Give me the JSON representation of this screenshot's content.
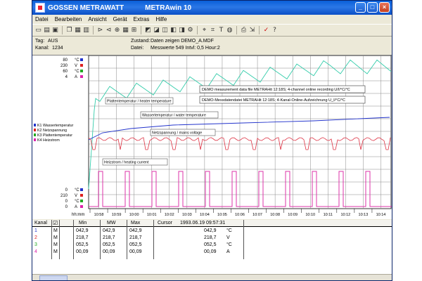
{
  "window": {
    "app_name": "GOSSEN METRAWATT",
    "title": "METRAwin 10"
  },
  "menu": [
    "Datei",
    "Bearbeiten",
    "Ansicht",
    "Gerät",
    "Extras",
    "Hilfe"
  ],
  "info": {
    "tag_label": "Tag:",
    "tag_value": "AUS",
    "kanal_label": "Kanal:",
    "kanal_value": "1234",
    "zustand_label": "Zustand:",
    "zustand_value": "Daten zeigen DEMO_A.MDF",
    "datei_label": "Datei:",
    "datei_value": "Messwerte 549  Intvl: 0,5  Hour:2"
  },
  "axis_labels": {
    "top_values": [
      "80",
      "230",
      "60",
      "4"
    ],
    "top_units": [
      "°C",
      "V",
      "°C",
      "A"
    ],
    "bottom_values": [
      "0",
      "210",
      "0",
      "0"
    ],
    "bottom_units": [
      "°C",
      "V",
      "°C",
      "A"
    ],
    "time_label": "hh:mm"
  },
  "time_ticks": [
    "10:58",
    "10:59",
    "10:00",
    "10:01",
    "10:02",
    "10:03",
    "10:04",
    "10:05",
    "10:06",
    "10:07",
    "10:08",
    "10:09",
    "10:10",
    "10:11",
    "10:12",
    "10:13",
    "10:14"
  ],
  "legend": [
    {
      "id": "K1",
      "name": "Wassertemperatur",
      "color": "#2233cc"
    },
    {
      "id": "K2",
      "name": "Netzspannung",
      "color": "#dd2222"
    },
    {
      "id": "K3",
      "name": "Plattentemperatur",
      "color": "#22aa22"
    },
    {
      "id": "K4",
      "name": "Heizstrom",
      "color": "#dd22aa"
    }
  ],
  "annotations": {
    "box1": "DEMO measurement data file METRAHit 12:18S; 4-channel online recording U/I/°C/°C",
    "box2": "DEMO-Messdatendatei METRAHit 12:18S; 4-Kanal-Online-Aufzeichnung U_I/°C/°C",
    "plate": "Plattentemperatur / heater temperature",
    "water": "Wassertemperatur / water temperature",
    "mains": "Netzspannung / mains voltage",
    "current": "Heizstrom / heating current"
  },
  "table": {
    "headers": [
      "Kanal",
      "Min",
      "MW",
      "Max",
      "Cursor",
      "1993.06.19 09:57:31"
    ],
    "rows": [
      {
        "k": "1",
        "kcolor": "#2233cc",
        "flag": "M",
        "min": "042,9",
        "mw": "042,9",
        "max": "042,9",
        "cur": "042,9",
        "unit": "°C"
      },
      {
        "k": "2",
        "kcolor": "#dd2222",
        "flag": "M",
        "min": "218,7",
        "mw": "218,7",
        "max": "218,7",
        "cur": "218,7",
        "unit": "V"
      },
      {
        "k": "3",
        "kcolor": "#22aa22",
        "flag": "M",
        "min": "052,5",
        "mw": "052,5",
        "max": "052,5",
        "cur": "052,5",
        "unit": "°C"
      },
      {
        "k": "4",
        "kcolor": "#dd22aa",
        "flag": "M",
        "min": "00,09",
        "mw": "00,09",
        "max": "00,09",
        "cur": "00,09",
        "unit": "A"
      }
    ]
  },
  "series_levels": {
    "plate_temperature": [
      0.0,
      0.55,
      0.62,
      0.7,
      0.74,
      0.8,
      0.82,
      0.83,
      0.84,
      0.86
    ],
    "water_temperature": [
      0.38,
      0.52
    ],
    "mains_voltage": 0.42,
    "heating_current_pulses": 12
  }
}
